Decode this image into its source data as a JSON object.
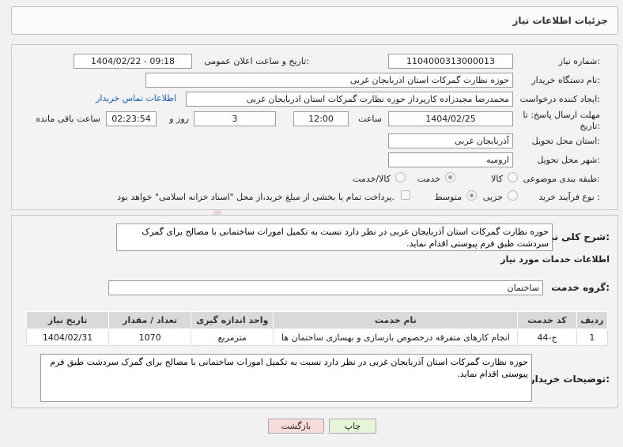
{
  "header": {
    "title": "جزئیات اطلاعات نیاز"
  },
  "form": {
    "need_number_label": "شماره نیاز:",
    "need_number": "1104000313000013",
    "announce_label": "تاریخ و ساعت اعلان عمومی:",
    "announce_value": "1404/02/22 - 09:18",
    "buyer_org_label": "نام دستگاه خریدار:",
    "buyer_org": "حوزه نظارت گمرکات استان اذربایجان غربی",
    "requester_label": "ایجاد کننده درخواست:",
    "requester": "محمدرضا مجیدزاده کارپرداز حوزه نظارت گمرکات استان اذربایجان غربی",
    "contact_link": "اطلاعات تماس خریدار",
    "deadline_label_1": "مهلت ارسال پاسخ: تا",
    "deadline_label_2": "تاریخ:",
    "deadline_date": "1404/02/25",
    "time_label": "ساعت",
    "deadline_time": "12:00",
    "days_value": "3",
    "days_label": "روز و",
    "remaining_time": "02:23:54",
    "remaining_label": "ساعت باقی مانده",
    "province_label": "استان محل تحویل:",
    "province": "آذربایجان غربی",
    "city_label": "شهر محل تحویل:",
    "city": "ارومیه",
    "category_label": "طبقه بندی موضوعی:",
    "category_options": [
      "کالا",
      "خدمت",
      "کالا/خدمت"
    ],
    "category_selected": "خدمت",
    "process_label": "نوع فرآیند خرید :",
    "process_options": [
      "جزیی",
      "متوسط"
    ],
    "process_selected": "متوسط",
    "payment_note": "پرداخت تمام یا بخشی از مبلغ خرید،از محل \"اسناد خزانه اسلامی\" خواهد بود."
  },
  "details": {
    "summary_label": "شرح کلی نیاز:",
    "summary": "حوزه نظارت گمرکات استان آذربایجان غربی در نظر دارد نسبت به تکمیل امورات ساختمانی با مصالح برای گمرک سردشت طبق فرم پیوستی اقدام نماید.",
    "services_heading": "اطلاعات خدمات مورد نیاز",
    "service_group_label": "گروه خدمت:",
    "service_group": "ساختمان",
    "table": {
      "headers": [
        "ردیف",
        "کد خدمت",
        "نام خدمت",
        "واحد اندازه گیری",
        "تعداد / مقدار",
        "تاریخ نیاز"
      ],
      "rows": [
        [
          "1",
          "ج-44",
          "انجام کارهای متفرقه درخصوص بازسازی و بهسازی ساختمان ها",
          "مترمربع",
          "1070",
          "1404/02/31"
        ]
      ]
    },
    "buyer_notes_label": "توضیحات خریدار:",
    "buyer_notes": "حوزه نظارت گمرکات استان آذربایجان غربی در نظر دارد نسبت به تکمیل امورات ساختمانی با مصالح برای گمرک سردشت طبق فرم پیوستی اقدام نماید."
  },
  "buttons": {
    "print": "چاپ",
    "back": "بازگشت"
  },
  "colors": {
    "print_bg": "#e6f5d8",
    "back_bg": "#f8dcdc",
    "link": "#1a5fb4"
  }
}
